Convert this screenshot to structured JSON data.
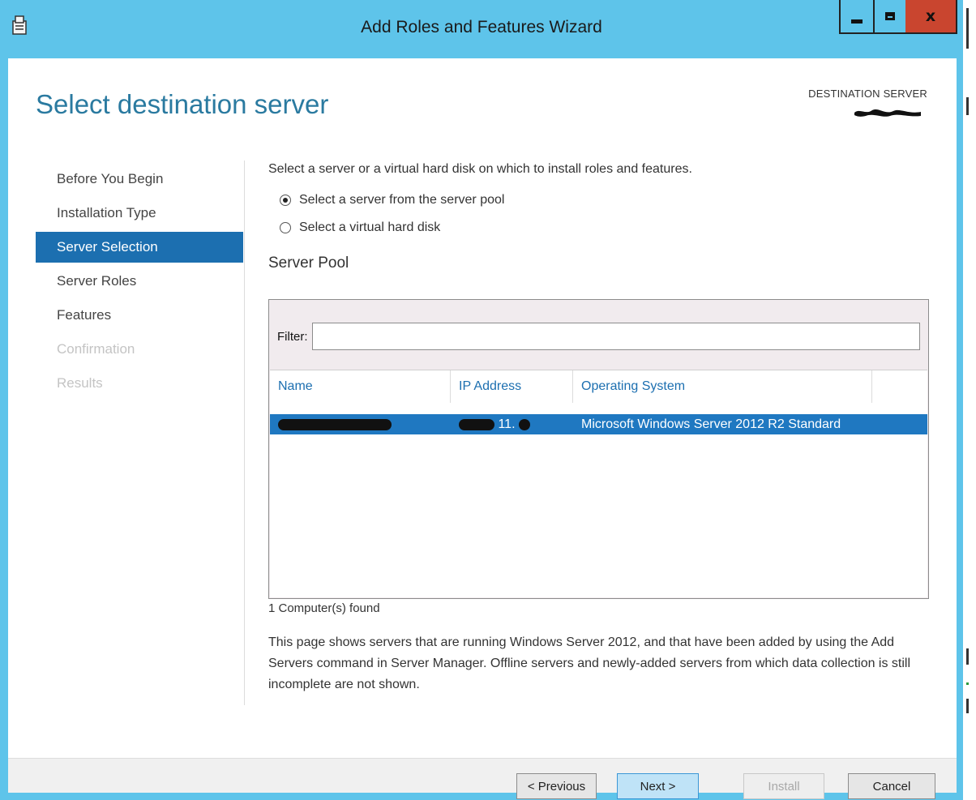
{
  "window": {
    "title": "Add Roles and Features Wizard",
    "minimize_label": "",
    "close_glyph": "x"
  },
  "header": {
    "page_title": "Select destination server",
    "destination_label": "DESTINATION SERVER"
  },
  "nav": {
    "items": [
      {
        "label": "Before You Begin",
        "state": "normal"
      },
      {
        "label": "Installation Type",
        "state": "normal"
      },
      {
        "label": "Server Selection",
        "state": "active"
      },
      {
        "label": "Server Roles",
        "state": "normal"
      },
      {
        "label": "Features",
        "state": "normal"
      },
      {
        "label": "Confirmation",
        "state": "disabled"
      },
      {
        "label": "Results",
        "state": "disabled"
      }
    ]
  },
  "content": {
    "intro": "Select a server or a virtual hard disk on which to install roles and features.",
    "options": [
      {
        "label": "Select a server from the server pool",
        "checked": true
      },
      {
        "label": "Select a virtual hard disk",
        "checked": false
      }
    ],
    "pool_title": "Server Pool",
    "filter_label": "Filter:",
    "filter_value": "",
    "columns": [
      "Name",
      "IP Address",
      "Operating System"
    ],
    "rows": [
      {
        "name": "",
        "ip_visible": "11.",
        "os": "Microsoft Windows Server 2012 R2 Standard",
        "selected": true
      }
    ],
    "found_text": "1 Computer(s) found",
    "note": "This page shows servers that are running Windows Server 2012, and that have been added by using the Add Servers command in Server Manager. Offline servers and newly-added servers from which data collection is still incomplete are not shown."
  },
  "footer": {
    "previous": "< Previous",
    "next": "Next >",
    "install": "Install",
    "cancel": "Cancel"
  },
  "colors": {
    "titlebar": "#5ec4ea",
    "accent": "#1c6fb0",
    "title_text": "#2a7aa0",
    "close_button": "#c9452f",
    "selected_row": "#1f78c1"
  }
}
